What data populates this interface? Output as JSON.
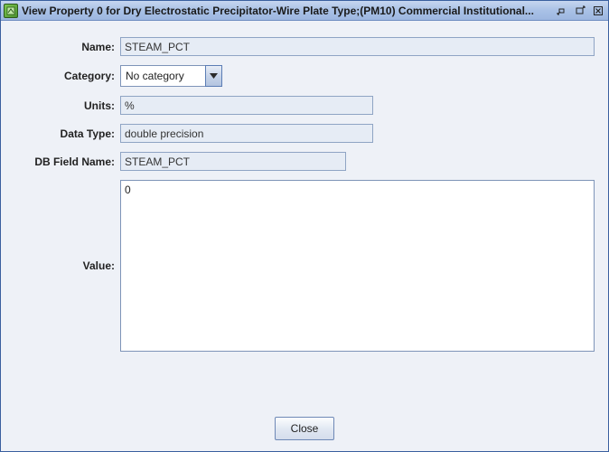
{
  "window": {
    "title": "View Property 0 for Dry Electrostatic Precipitator-Wire Plate Type;(PM10) Commercial Institutional..."
  },
  "labels": {
    "name": "Name:",
    "category": "Category:",
    "units": "Units:",
    "dataType": "Data Type:",
    "dbFieldName": "DB Field Name:",
    "value": "Value:"
  },
  "fields": {
    "name": "STEAM_PCT",
    "categorySelected": "No category",
    "units": "%",
    "dataType": "double precision",
    "dbFieldName": "STEAM_PCT",
    "value": "0"
  },
  "buttons": {
    "close": "Close"
  }
}
